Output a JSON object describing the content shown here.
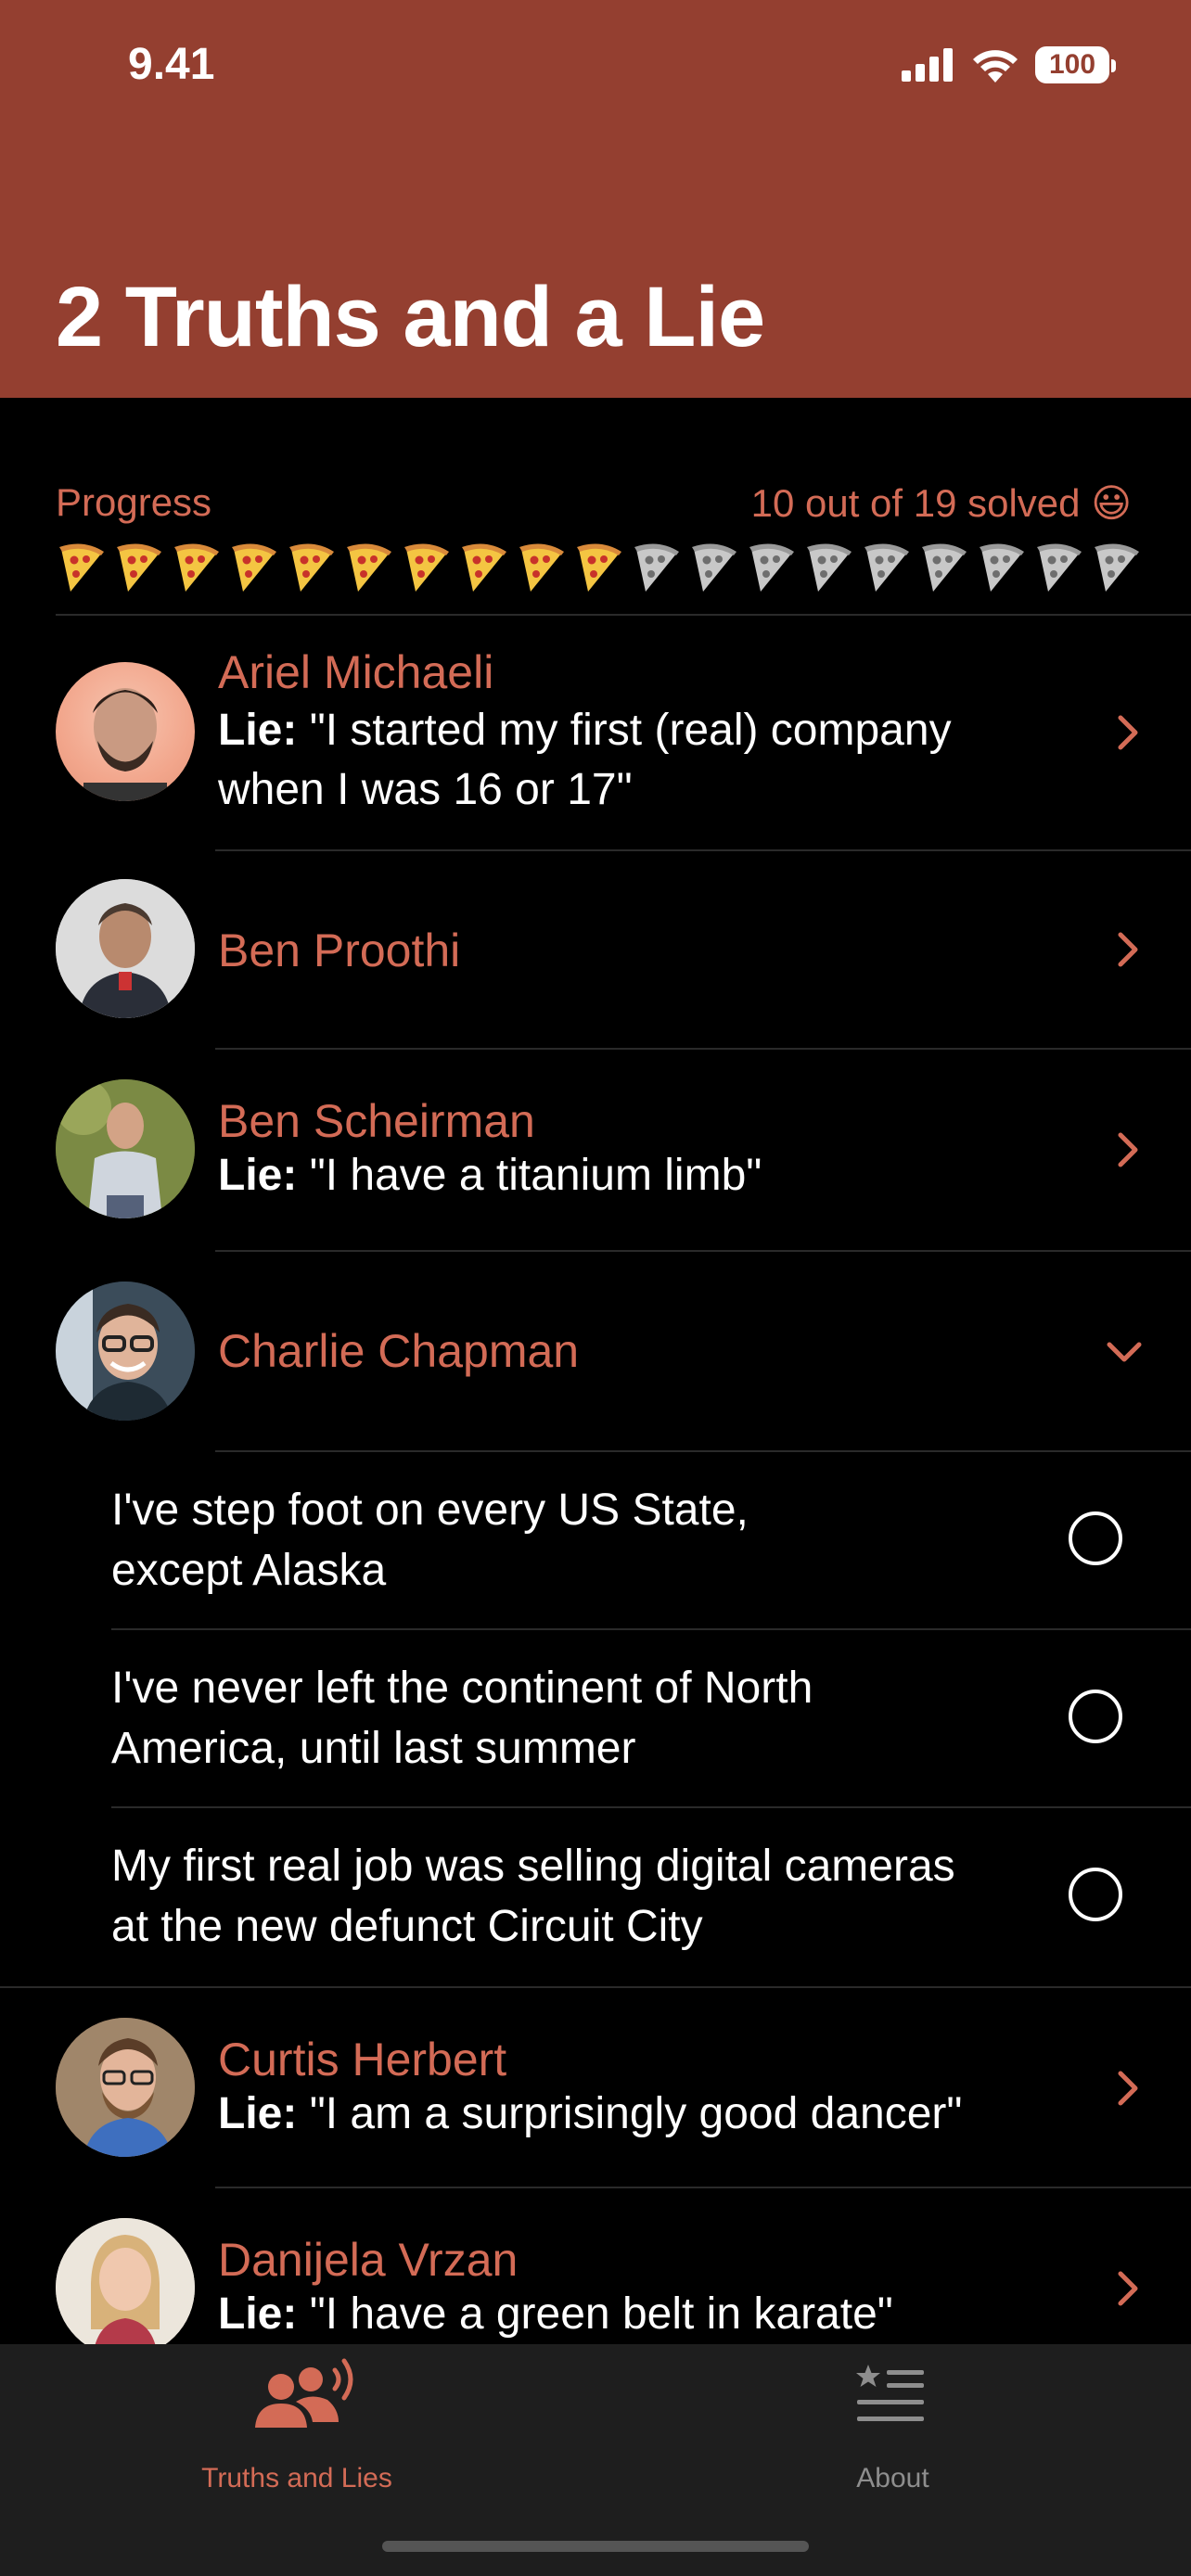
{
  "status": {
    "time": "9.41",
    "battery": "100"
  },
  "title": "2 Truths and a Lie",
  "progress": {
    "label": "Progress",
    "solved_text": "10 out of 19 solved",
    "emoji": "😃",
    "solved": 10,
    "total": 19
  },
  "people": [
    {
      "name": "Ariel Michaeli",
      "lie_prefix": "Lie:",
      "lie_line1": "\"I started my first (real) company",
      "lie_line2": "when I was 16 or 17\""
    },
    {
      "name": "Ben Proothi"
    },
    {
      "name": "Ben Scheirman",
      "lie_prefix": "Lie:",
      "lie": "\"I have a titanium limb\""
    },
    {
      "name": "Charlie Chapman",
      "statements": [
        {
          "line1": "I've step foot on every US State,",
          "line2": "except Alaska"
        },
        {
          "line1": "I've never left the continent of North",
          "line2": "America, until last summer"
        },
        {
          "line1": "My first real job was selling digital cameras",
          "line2": "at the new defunct Circuit City"
        }
      ]
    },
    {
      "name": "Curtis Herbert",
      "lie_prefix": "Lie:",
      "lie": "\"I am a surprisingly good dancer\""
    },
    {
      "name": "Danijela Vrzan",
      "lie_prefix": "Lie:",
      "lie": "\"I have a green belt in karate\""
    }
  ],
  "tabs": [
    {
      "label": "Truths and Lies",
      "icon": "people-speaking-icon",
      "active": true
    },
    {
      "label": "About",
      "icon": "list-star-icon",
      "active": false
    }
  ],
  "colors": {
    "accent": "#d36b56",
    "header": "#943f30"
  }
}
